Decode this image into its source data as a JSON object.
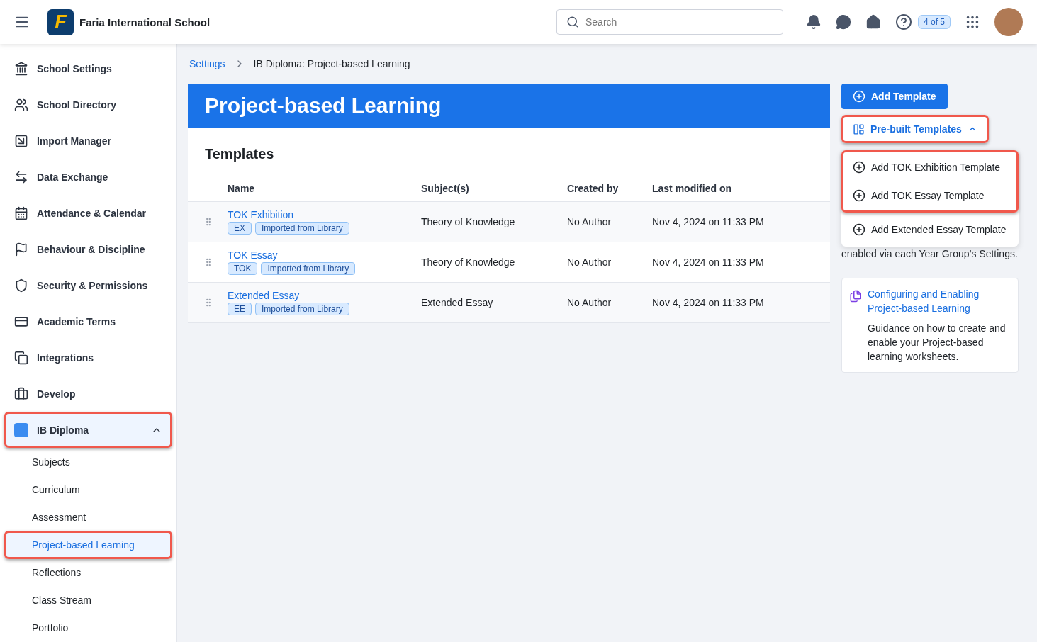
{
  "topbar": {
    "logo_letter": "F",
    "school": "Faria International School",
    "search": {
      "placeholder": "Search"
    },
    "badge": "4 of 5"
  },
  "sidebar": {
    "items": [
      {
        "label": "School Settings",
        "expanded": false,
        "highlighted": false
      },
      {
        "label": "School Directory",
        "expanded": false,
        "highlighted": false
      },
      {
        "label": "Import Manager",
        "expanded": false,
        "highlighted": false
      },
      {
        "label": "Data Exchange",
        "expanded": false,
        "highlighted": false
      },
      {
        "label": "Attendance & Calendar",
        "expanded": false,
        "highlighted": false
      },
      {
        "label": "Behaviour & Discipline",
        "expanded": false,
        "highlighted": false
      },
      {
        "label": "Security & Permissions",
        "expanded": false,
        "highlighted": false
      },
      {
        "label": "Academic Terms",
        "expanded": false,
        "highlighted": false
      },
      {
        "label": "Integrations",
        "expanded": false,
        "highlighted": false
      },
      {
        "label": "Develop",
        "expanded": false,
        "highlighted": false
      },
      {
        "label": "IB Diploma",
        "expanded": true,
        "highlighted": true,
        "children": [
          {
            "label": "Subjects",
            "selected": false,
            "highlighted": false
          },
          {
            "label": "Curriculum",
            "selected": false,
            "highlighted": false
          },
          {
            "label": "Assessment",
            "selected": false,
            "highlighted": false
          },
          {
            "label": "Project-based Learning",
            "selected": true,
            "highlighted": true
          },
          {
            "label": "Reflections",
            "selected": false,
            "highlighted": false
          },
          {
            "label": "Class Stream",
            "selected": false,
            "highlighted": false
          },
          {
            "label": "Portfolio",
            "selected": false,
            "highlighted": false
          }
        ]
      }
    ]
  },
  "breadcrumb": {
    "link": "Settings",
    "current": "IB Diploma: Project-based Learning"
  },
  "banner": {
    "title": "Project-based Learning"
  },
  "templates": {
    "heading": "Templates",
    "columns": [
      "Name",
      "Subject(s)",
      "Created by",
      "Last modified on"
    ],
    "rows": [
      {
        "name": "TOK Exhibition",
        "tags": [
          "EX",
          "Imported from Library"
        ],
        "subject": "Theory of Knowledge",
        "author": "No Author",
        "modified": "Nov 4, 2024 on 11:33 PM"
      },
      {
        "name": "TOK Essay",
        "tags": [
          "TOK",
          "Imported from Library"
        ],
        "subject": "Theory of Knowledge",
        "author": "No Author",
        "modified": "Nov 4, 2024 on 11:33 PM"
      },
      {
        "name": "Extended Essay",
        "tags": [
          "EE",
          "Imported from Library"
        ],
        "subject": "Extended Essay",
        "author": "No Author",
        "modified": "Nov 4, 2024 on 11:33 PM"
      }
    ]
  },
  "actions": {
    "add": "Add Template",
    "prebuilt": {
      "label": "Pre-built Templates",
      "expanded": true,
      "highlighted": true
    },
    "menu_groups": [
      {
        "highlighted": true,
        "items": [
          "Add TOK Exhibition Template",
          "Add TOK Essay Template"
        ]
      },
      {
        "highlighted": false,
        "items": [
          "Add Extended Essay Template"
        ]
      }
    ]
  },
  "note": "enabled via each Year Group’s Settings.",
  "help_card": {
    "link": "Configuring and Enabling Project-based Learning",
    "text": "Guidance on how to create and enable your Project-based learning worksheets."
  }
}
